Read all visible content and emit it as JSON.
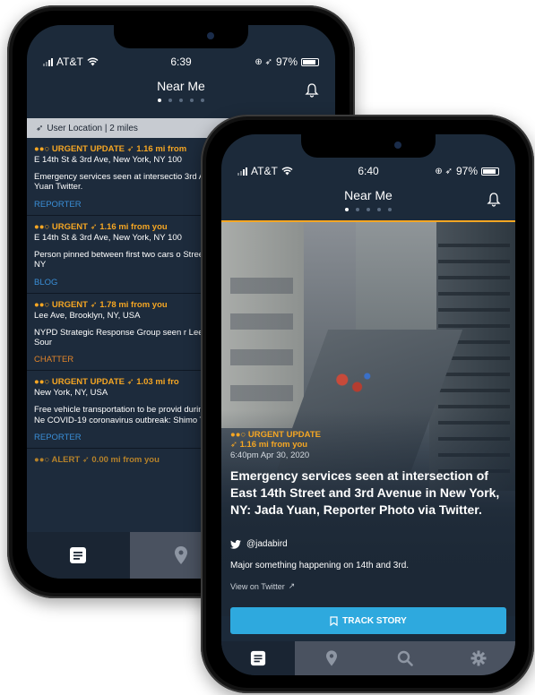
{
  "back": {
    "status": {
      "carrier": "AT&T",
      "time": "6:39",
      "battery": "97%"
    },
    "header": {
      "title": "Near Me"
    },
    "location_bar": {
      "label": "User Location | 2 miles"
    },
    "items": [
      {
        "tag": "●●○ URGENT UPDATE ➶ 1.16 mi from",
        "addr": "E 14th St & 3rd Ave, New York, NY 100",
        "body": "Emergency services seen at intersectio 3rd Avenue in New York, NY: Jada Yuan Twitter.",
        "source": "REPORTER",
        "source_color": "#3a8ed6"
      },
      {
        "tag": "●●○ URGENT ➶ 1.16 mi from you",
        "addr": "E 14th St & 3rd Ave, New York, NY 100",
        "body": "Person pinned between first two cars o Street and 3rd Avenue in New York, NY",
        "source": "BLOG",
        "source_color": "#3a8ed6"
      },
      {
        "tag": "●●○ URGENT ➶ 1.78 mi from you",
        "addr": "Lee Ave, Brooklyn, NY, USA",
        "body": "NYPD Strategic Response Group seen r Lee Avenue in Brooklyn, NY: Local Sour",
        "source": "CHATTER",
        "source_color": "#e0842a"
      },
      {
        "tag": "●●○ URGENT UPDATE ➶ 1.03 mi fro",
        "addr": "New York, NY, USA",
        "body": "Free vehicle transportation to be provid during MTA daily shutdown hours in Ne COVID-19 coronavirus outbreak: Shimo Twitter.",
        "source": "REPORTER",
        "source_color": "#3a8ed6"
      }
    ],
    "partial_item": "●●○ ALERT ➶ 0.00 mi from you"
  },
  "front": {
    "status": {
      "carrier": "AT&T",
      "time": "6:40",
      "battery": "97%"
    },
    "header": {
      "title": "Near Me"
    },
    "story": {
      "urgency": "●●○ URGENT UPDATE",
      "distance": "➶ 1.16 mi from you",
      "timestamp": "6:40pm Apr 30, 2020",
      "headline": "Emergency services seen at intersection of East 14th Street and 3rd Avenue in New York, NY: Jada Yuan, Reporter Photo via Twitter."
    },
    "tweet": {
      "handle": "@jadabird",
      "text": "Major something happening on 14th and 3rd.",
      "view_link": "View on Twitter"
    },
    "track_button": "TRACK STORY"
  },
  "icons": [
    "signal-icon",
    "wifi-icon",
    "location-icon",
    "battery-icon",
    "bell-icon",
    "location-arrow-icon",
    "feed-icon",
    "map-pin-icon",
    "search-icon",
    "gear-icon",
    "twitter-icon",
    "external-link-icon",
    "bookmark-icon"
  ],
  "colors": {
    "accent": "#f5a623",
    "primary_button": "#2ea9de",
    "background": "#1c2a3a"
  }
}
